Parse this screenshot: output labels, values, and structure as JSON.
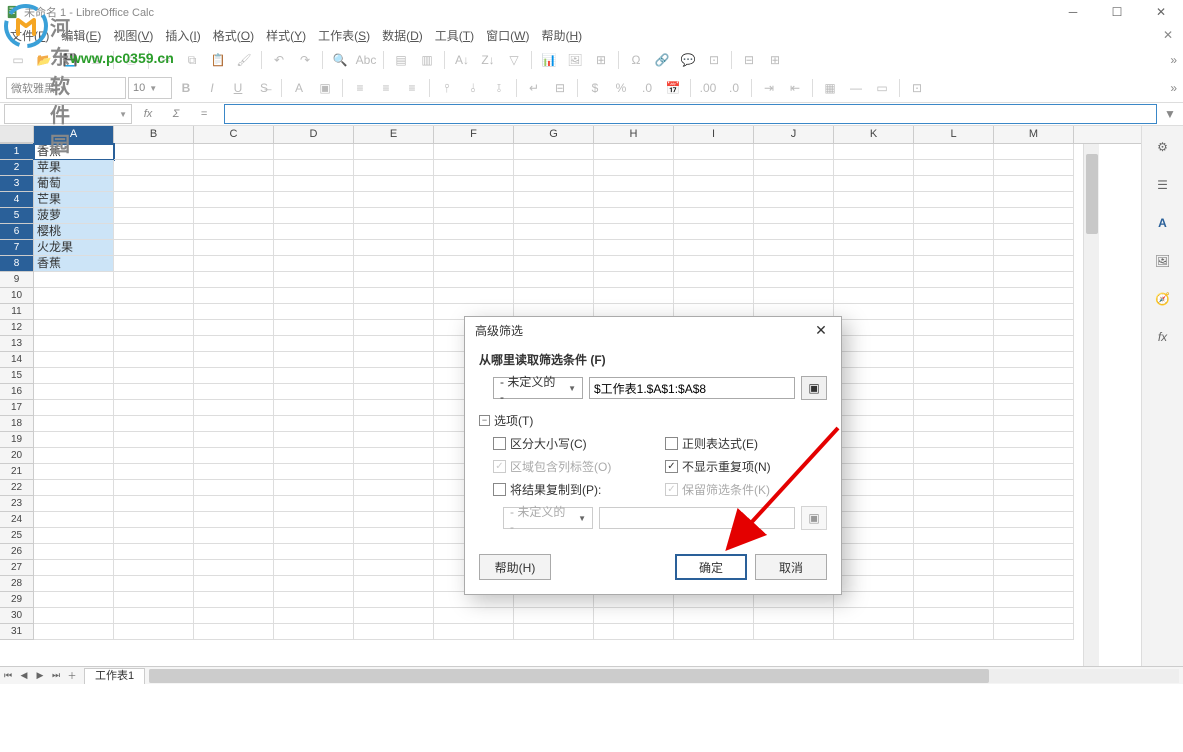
{
  "window": {
    "title": "未命名 1 - LibreOffice Calc"
  },
  "watermark": {
    "cn": "河东软件园",
    "url": "www.pc0359.cn"
  },
  "menu": {
    "items": [
      "文件(F)",
      "编辑(E)",
      "视图(V)",
      "插入(I)",
      "格式(O)",
      "样式(Y)",
      "工作表(S)",
      "数据(D)",
      "工具(T)",
      "窗口(W)",
      "帮助(H)"
    ]
  },
  "format_toolbar": {
    "font_name": "微软雅黑",
    "font_size": "10"
  },
  "formula_bar": {
    "name_box": "",
    "formula": ""
  },
  "columns": [
    "A",
    "B",
    "C",
    "D",
    "E",
    "F",
    "G",
    "H",
    "I",
    "J",
    "K",
    "L",
    "M"
  ],
  "cells": {
    "A1": "香蕉",
    "A2": "苹果",
    "A3": "葡萄",
    "A4": "芒果",
    "A5": "菠萝",
    "A6": "樱桃",
    "A7": "火龙果",
    "A8": "香蕉"
  },
  "sheet_tab": "工作表1",
  "dialog": {
    "title": "高级筛选",
    "section1_label": "从哪里读取筛选条件 (F)",
    "source_combo": "- 未定义的 -",
    "source_range": "$工作表1.$A$1:$A$8",
    "options_label": "选项(T)",
    "opt_case": "区分大小写(C)",
    "opt_regex": "正则表达式(E)",
    "opt_header": "区域包含列标签(O)",
    "opt_nodup": "不显示重复项(N)",
    "opt_copy": "将结果复制到(P):",
    "opt_keep": "保留筛选条件(K)",
    "dest_combo": "- 未定义的 -",
    "help": "帮助(H)",
    "ok": "确定",
    "cancel": "取消"
  }
}
